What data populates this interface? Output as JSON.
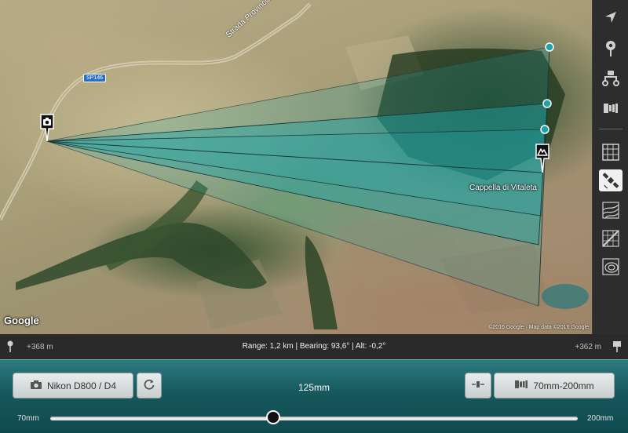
{
  "map": {
    "road_label": "Strada Provinciale 146 di Chiat",
    "road_badge": "SP146",
    "place_label": "Cappella di Vitaleta",
    "logo": "Google",
    "copyright": "©2016 Google · Map data ©2016 Google",
    "camera_marker_icon": "camera-pin-icon",
    "subject_marker_icon": "mountain-pin-icon"
  },
  "toolbar": {
    "items": [
      {
        "name": "navigate-icon"
      },
      {
        "name": "pin-icon"
      },
      {
        "name": "camera-subject-icon"
      },
      {
        "name": "lens-icon"
      },
      {
        "name": "map-type-grid-icon"
      },
      {
        "name": "satellite-icon"
      },
      {
        "name": "terrain-icon"
      },
      {
        "name": "hybrid-icon"
      },
      {
        "name": "topo-icon"
      }
    ],
    "active": "satellite-icon"
  },
  "info": {
    "alt_left": "+368 m",
    "alt_right": "+362 m",
    "range_text": "Range: 1,2 km | Bearing: 93,6° | Alt: -0,2°"
  },
  "panel": {
    "camera_button": "Nikon D800 / D4",
    "focal_length": "125mm",
    "lens_button": "70mm-200mm",
    "slider": {
      "min_label": "70mm",
      "max_label": "200mm",
      "min": 70,
      "max": 200,
      "value": 125
    }
  },
  "colors": {
    "accent": "#2d7b80",
    "fov_fill": "#1fa3a6"
  }
}
